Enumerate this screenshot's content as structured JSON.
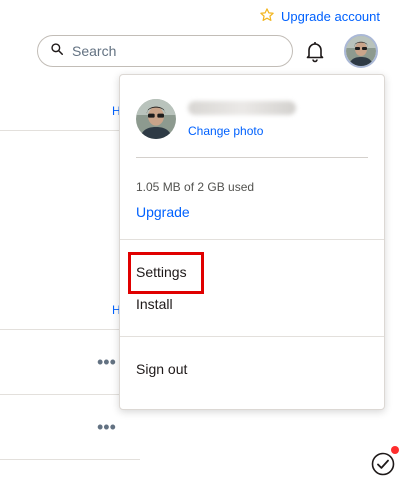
{
  "header": {
    "upgrade_account_label": "Upgrade account",
    "search_placeholder": "Search"
  },
  "background": {
    "partial_letter_1": "H",
    "partial_letter_2": "H",
    "row_menu_glyph": "•••"
  },
  "account_menu": {
    "change_photo_label": "Change photo",
    "storage_usage": "1.05 MB of 2 GB used",
    "upgrade_label": "Upgrade",
    "settings_label": "Settings",
    "install_label": "Install",
    "sign_out_label": "Sign out"
  },
  "icons": {
    "upgrade": "star-outline-icon",
    "search": "magnifier-icon",
    "notifications": "bell-icon",
    "activity": "check-circle-icon"
  },
  "colors": {
    "link_blue": "#0061fe",
    "highlight_red": "#e00000",
    "star_gold": "#f2b51d",
    "notification_red": "#ff2d2d"
  }
}
